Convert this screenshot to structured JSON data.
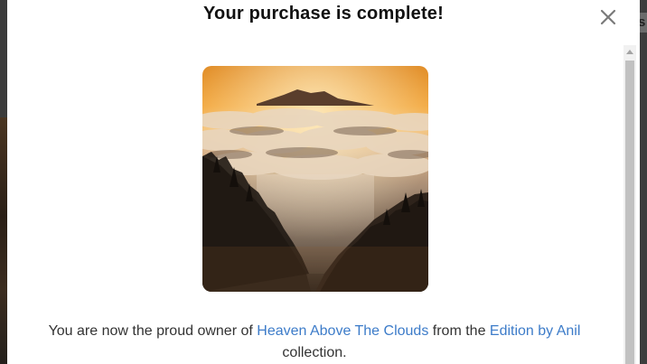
{
  "modal": {
    "title": "Your purchase is complete!",
    "close_icon": "close-icon",
    "message": {
      "prefix": "You are now the proud owner of ",
      "artwork_link": "Heaven Above The Clouds",
      "middle": " from the ",
      "collection_link": "Edition by Anil",
      "suffix": " collection."
    },
    "artwork": {
      "description_icon": "artwork-image"
    }
  },
  "background": {
    "partial_text": "s"
  },
  "colors": {
    "link": "#3d7cc9",
    "title": "#111111",
    "body_text": "#333333",
    "close_icon": "#7a7a7a"
  }
}
